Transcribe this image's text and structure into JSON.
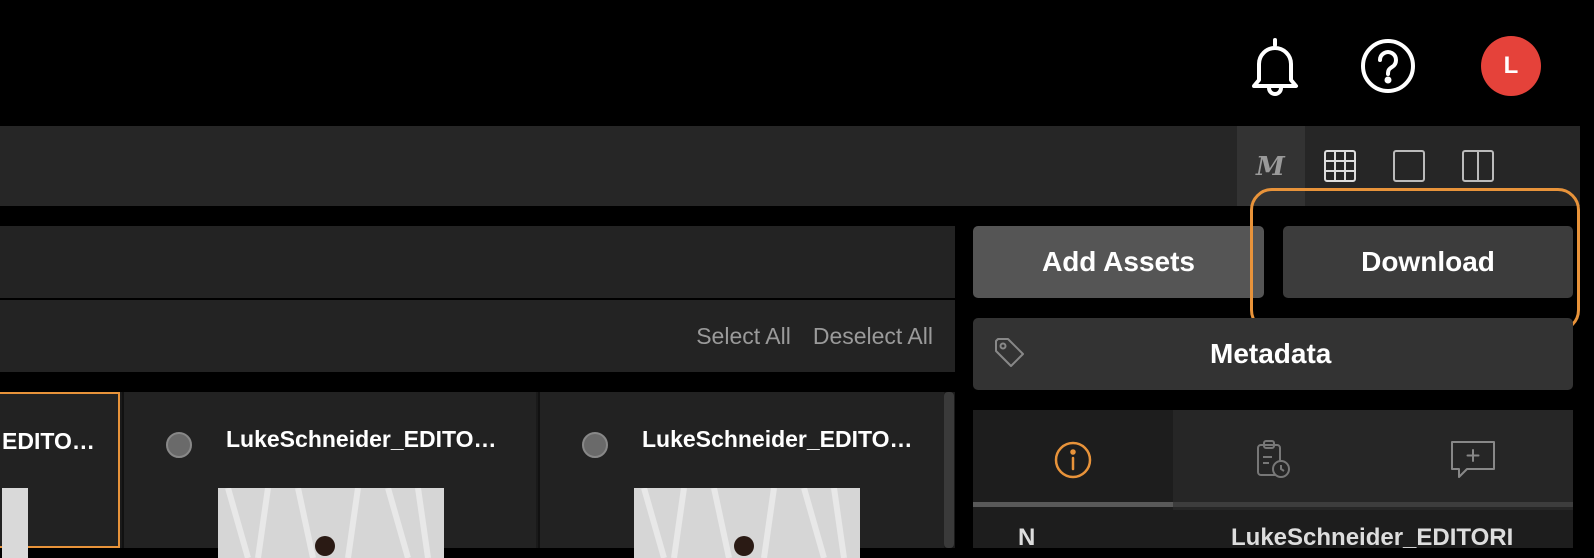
{
  "header": {
    "bell_icon": "bell-icon",
    "help_icon": "help-icon",
    "avatar_initial": "L",
    "avatar_color": "#e5423a"
  },
  "view_toolbar": {
    "buttons": [
      "m-logo-icon",
      "grid-view-icon",
      "single-view-icon",
      "split-view-icon"
    ]
  },
  "selection": {
    "select_all": "Select All",
    "deselect_all": "Deselect All"
  },
  "assets": [
    {
      "name": "LukeSchneider_EDITO…",
      "display": "EDITO…",
      "selected": true
    },
    {
      "name": "LukeSchneider_EDITO…",
      "selected": false
    },
    {
      "name": "LukeSchneider_EDITO…",
      "selected": false
    }
  ],
  "actions": {
    "add_assets": "Add Assets",
    "download": "Download"
  },
  "metadata": {
    "label": "Metadata"
  },
  "info_tabs": [
    "info-icon",
    "clipboard-clock-icon",
    "add-comment-icon"
  ],
  "detail": {
    "name_label": "N",
    "name_value": "LukeSchneider_EDITORI"
  },
  "colors": {
    "accent": "#e8933a",
    "avatar": "#e5423a"
  }
}
